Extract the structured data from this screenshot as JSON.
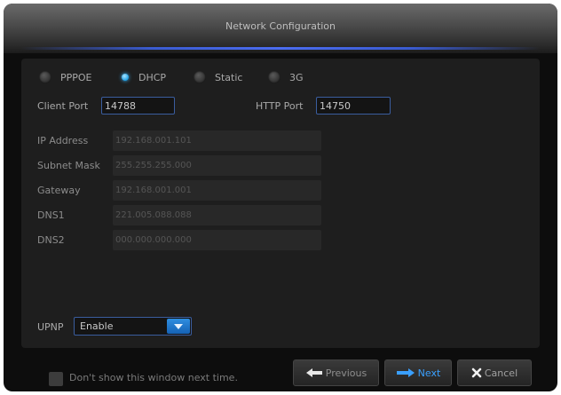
{
  "dialog": {
    "title": "Network Configuration"
  },
  "connection_modes": [
    {
      "label": "PPPOE",
      "selected": false
    },
    {
      "label": "DHCP",
      "selected": true
    },
    {
      "label": "Static",
      "selected": false
    },
    {
      "label": "3G",
      "selected": false
    }
  ],
  "ports": {
    "client_label": "Client Port",
    "client_value": "14788",
    "http_label": "HTTP Port",
    "http_value": "14750"
  },
  "fields": [
    {
      "label": "IP Address",
      "value": "192.168.001.101"
    },
    {
      "label": "Subnet Mask",
      "value": "255.255.255.000"
    },
    {
      "label": "Gateway",
      "value": "192.168.001.001"
    },
    {
      "label": "DNS1",
      "value": "221.005.088.088"
    },
    {
      "label": "DNS2",
      "value": "000.000.000.000"
    }
  ],
  "upnp": {
    "label": "UPNP",
    "value": "Enable"
  },
  "footer": {
    "checkbox_label": "Don't show this window next time.",
    "previous_label": "Previous",
    "next_label": "Next",
    "cancel_label": "Cancel"
  },
  "colors": {
    "accent": "#1ea0e6",
    "next_text": "#3aa0ff",
    "field_border": "#3a5d9e"
  },
  "icons": [
    "radio-icon",
    "dropdown-arrow-icon",
    "checkbox-icon",
    "arrow-left-icon",
    "arrow-right-icon",
    "close-x-icon"
  ]
}
